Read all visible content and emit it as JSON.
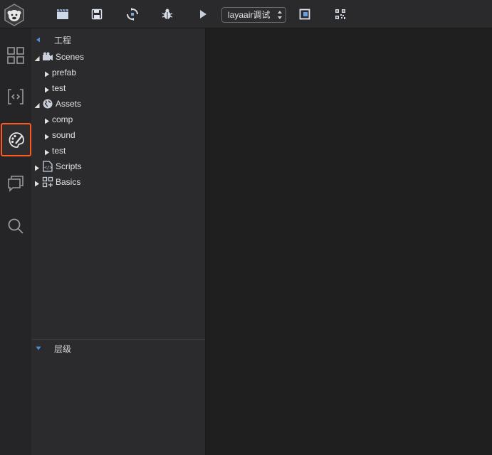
{
  "toolbar": {
    "logo_icon": "laya-monkey-logo-icon",
    "buttons": [
      {
        "icon": "clapperboard-icon"
      },
      {
        "icon": "save-icon"
      },
      {
        "icon": "publish-sync-icon"
      },
      {
        "icon": "debug-bug-icon"
      },
      {
        "icon": "play-icon"
      }
    ],
    "run_target": "layaair调试",
    "after_select": [
      {
        "icon": "open-window-icon"
      },
      {
        "icon": "qr-code-icon"
      }
    ]
  },
  "activity_bar": {
    "items": [
      {
        "icon": "layout-grid-icon"
      },
      {
        "icon": "code-editor-icon"
      },
      {
        "icon": "palette-icon",
        "active": true
      },
      {
        "icon": "chat-icon"
      },
      {
        "icon": "search-icon"
      }
    ],
    "accent": "#ff5a1f"
  },
  "project_panel": {
    "title": "工程",
    "tree": [
      {
        "label": "Scenes",
        "icon": "camera-icon",
        "level": 0,
        "expanded": true
      },
      {
        "label": "prefab",
        "level": 1,
        "expanded": false
      },
      {
        "label": "test",
        "level": 1,
        "expanded": false
      },
      {
        "label": "Assets",
        "icon": "globe-icon",
        "level": 0,
        "expanded": true
      },
      {
        "label": "comp",
        "level": 1,
        "expanded": false
      },
      {
        "label": "sound",
        "level": 1,
        "expanded": false
      },
      {
        "label": "test",
        "level": 1,
        "expanded": false
      },
      {
        "label": "Scripts",
        "icon": "script-file-icon",
        "level": 0,
        "expanded": false
      },
      {
        "label": "Basics",
        "icon": "components-grid-icon",
        "level": 0,
        "expanded": false
      }
    ]
  },
  "hierarchy_panel": {
    "title": "层级"
  }
}
